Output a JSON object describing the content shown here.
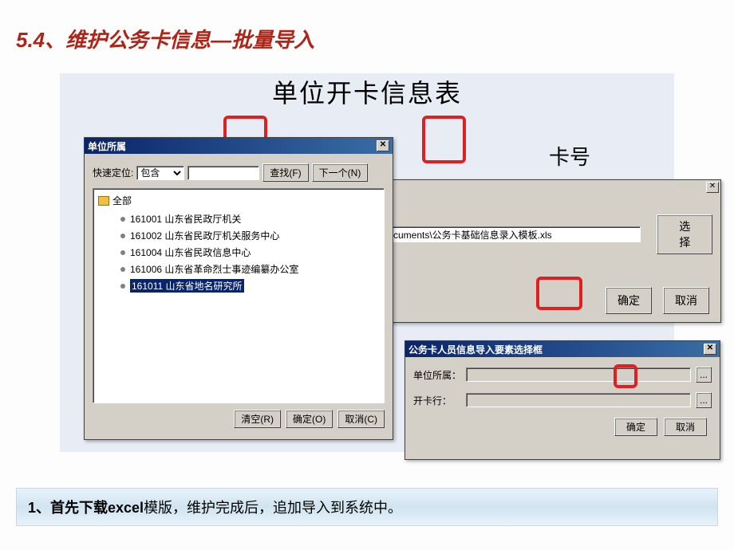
{
  "slide": {
    "title": "5.4、维护公务卡信息—批量导入",
    "content_title": "单位开卡信息表",
    "card_number_label": "卡号"
  },
  "dlg_unit": {
    "title": "单位所属",
    "search_label": "快速定位:",
    "search_mode": "包含",
    "search_value": "",
    "find_btn": "查找(F)",
    "next_btn": "下一个(N)",
    "root": "全部",
    "items": [
      {
        "code": "161001",
        "name": "山东省民政厅机关",
        "selected": false
      },
      {
        "code": "161002",
        "name": "山东省民政厅机关服务中心",
        "selected": false
      },
      {
        "code": "161004",
        "name": "山东省民政信息中心",
        "selected": false
      },
      {
        "code": "161006",
        "name": "山东省革命烈士事迹编纂办公室",
        "selected": false
      },
      {
        "code": "161011",
        "name": "山东省地名研究所",
        "selected": true
      }
    ],
    "clear_btn": "清空(R)",
    "ok_btn": "确定(O)",
    "cancel_btn": "取消(C)"
  },
  "dlg_file": {
    "path": "cuments\\公务卡基础信息录入模板.xls",
    "choose_btn": "选择",
    "ok_btn": "确定",
    "cancel_btn": "取消"
  },
  "dlg_select": {
    "title": "公务卡人员信息导入要素选择框",
    "unit_label": "单位所属：",
    "unit_value": "",
    "bank_label": "开卡行：",
    "bank_value": "",
    "ellipsis": "...",
    "ok_btn": "确定",
    "cancel_btn": "取消"
  },
  "footer": {
    "prefix": "1、首先下载",
    "bold": "excel",
    "suffix": "模版，维护完成后，追加导入到系统中。"
  }
}
